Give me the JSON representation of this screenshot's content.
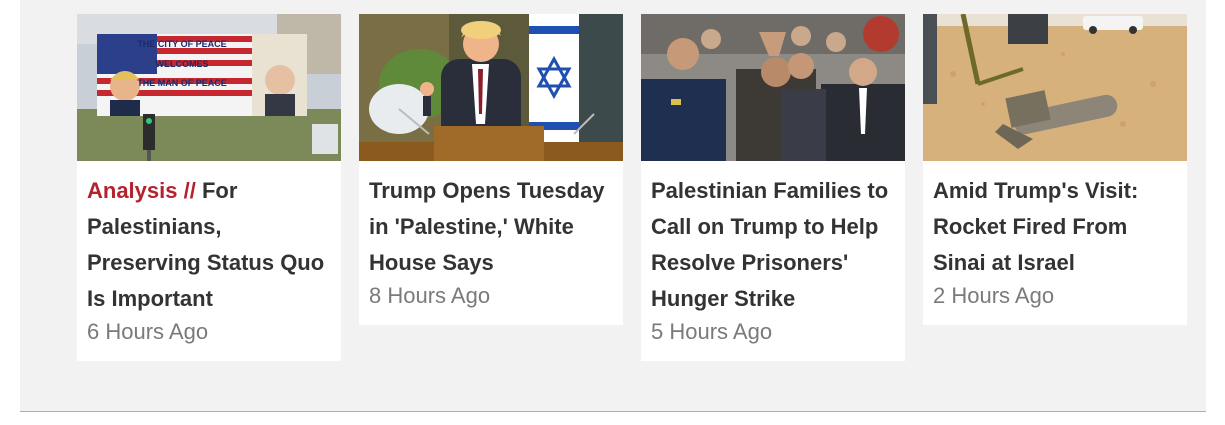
{
  "articles": [
    {
      "kicker": "Analysis //",
      "title": "For Palestinians, Preserving Status Quo Is Important",
      "time": "6 Hours Ago",
      "image": {
        "alt": "Billboard with Trump and Abbas",
        "banner_lines": [
          "THE CITY OF PEACE",
          "WELCOMES",
          "THE MAN OF PEACE"
        ]
      }
    },
    {
      "kicker": "",
      "title": "Trump Opens Tuesday in 'Palestine,' White House Says",
      "time": "8 Hours Ago",
      "image": {
        "alt": "Trump speaking at podium with Israeli flag"
      }
    },
    {
      "kicker": "",
      "title": "Palestinian Families to Call on Trump to Help Resolve Prisoners' Hunger Strike",
      "time": "5 Hours Ago",
      "image": {
        "alt": "Man in handcuffs escorted by police"
      }
    },
    {
      "kicker": "",
      "title": "Amid Trump's Visit: Rocket Fired From Sinai at Israel",
      "time": "2 Hours Ago",
      "image": {
        "alt": "Rocket remains on sandy ground"
      }
    }
  ],
  "colors": {
    "kicker": "#b3232d",
    "headline": "#333333",
    "timestamp": "#7a7a7a",
    "strip_background": "#f2f2f2"
  }
}
